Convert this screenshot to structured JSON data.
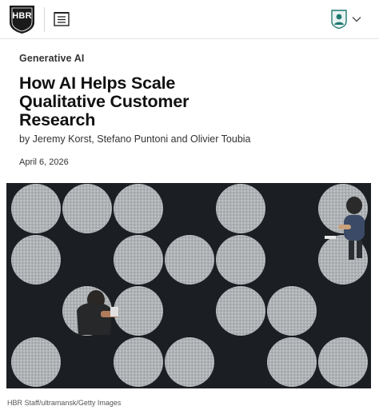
{
  "header": {
    "logo_text": "HBR",
    "logo_icon": "hbr-shield-logo",
    "menu_icon": "menu-list-icon",
    "account_icon": "user-avatar-icon",
    "account_chevron_icon": "chevron-down-icon"
  },
  "article": {
    "category": "Generative AI",
    "title": "How AI Helps Scale Qualitative Customer Research",
    "byline": "by Jeremy Korst, Stefano Puntoni and Olivier Toubia",
    "date": "April 6, 2026"
  },
  "hero_image": {
    "description_icon": "hero-photo",
    "caption": "HBR Staff/ultramansk/Getty Images"
  },
  "colors": {
    "logo_fill": "#1a1a1a",
    "avatar_accent": "#1f7a70",
    "hero_bg": "#1b1e22",
    "circle_tile": "#b9bcbf"
  }
}
